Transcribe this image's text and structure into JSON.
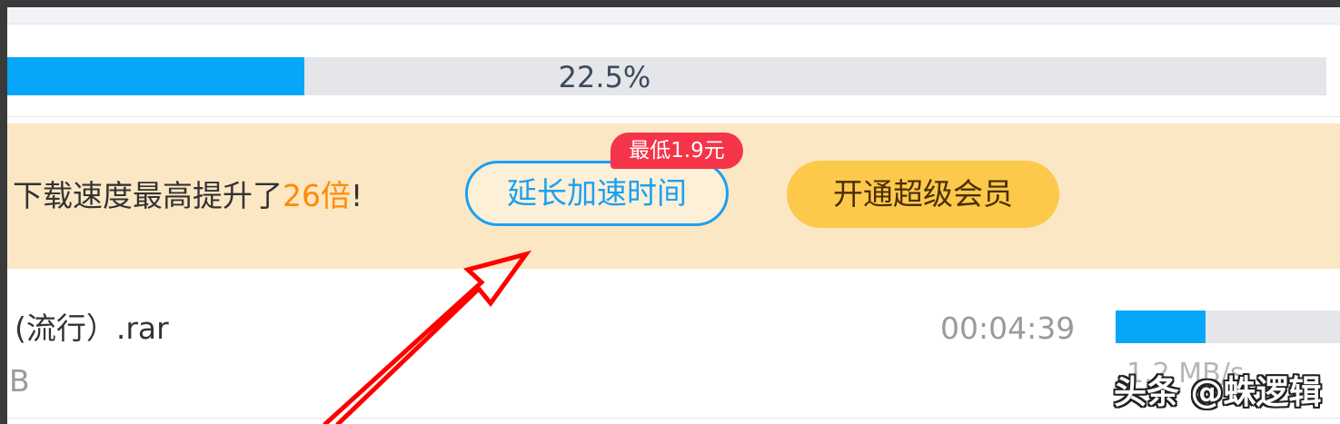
{
  "total_progress": {
    "percent": 22.5,
    "label": "22.5%"
  },
  "promo": {
    "text_prefix": "下载速度最高提升了",
    "text_highlight": "26倍",
    "text_suffix": "!",
    "extend_button_label": "延长加速时间",
    "price_badge": "最低1.9元",
    "vip_button_label": "开通超级会员"
  },
  "download_item": {
    "name": "(流行）.rar",
    "size": "B",
    "time_remaining": "00:04:39",
    "progress_percent": 40,
    "speed": "1.2 MB/s"
  },
  "watermark": "头条 @蛛逻辑",
  "colors": {
    "accent_blue": "#06a7f8",
    "promo_bg": "#fce7c5",
    "highlight_orange": "#ff8a00",
    "badge_red": "#f5344a",
    "vip_gold": "#fcc94b",
    "annotation_red": "#ff0000"
  }
}
